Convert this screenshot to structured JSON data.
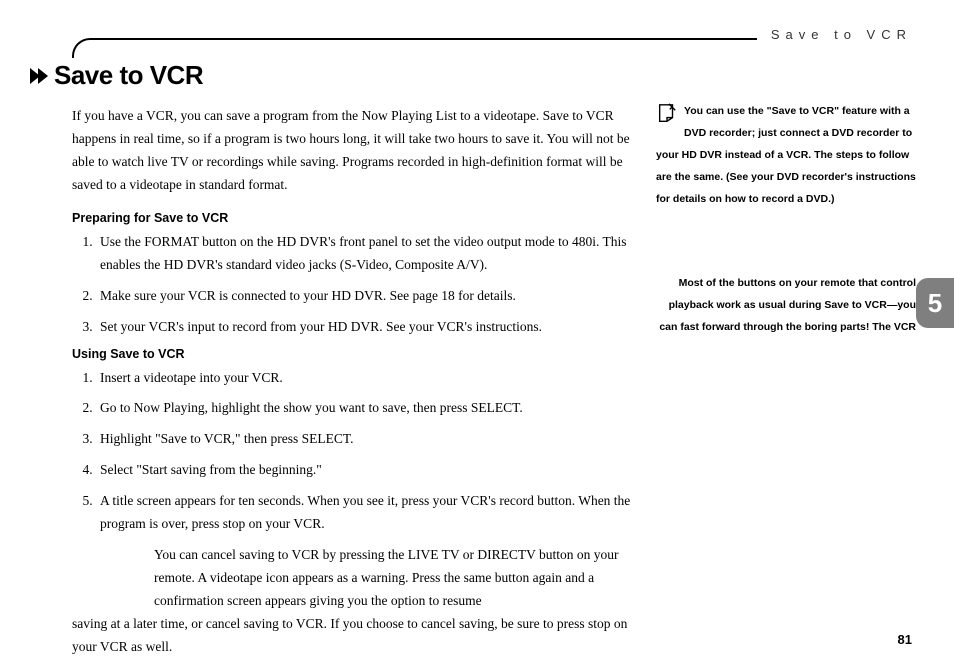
{
  "header": {
    "running_title": "Save to VCR"
  },
  "title": "Save to VCR",
  "intro": "If you have a VCR, you can save a program from the Now Playing List to a videotape. Save to VCR happens in real time, so if a program is two hours long, it will take two hours to save it. You will not be able to watch live TV or recordings while saving. Programs recorded in high-definition format will be saved to a videotape in standard format.",
  "section1": {
    "heading": "Preparing for Save to VCR",
    "steps": [
      "Use the FORMAT button on the HD DVR's front panel to set the video output mode to 480i. This enables the HD DVR's standard video jacks (S-Video, Composite A/V).",
      "Make sure your VCR is connected to your HD DVR. See page 18 for details.",
      "Set your VCR's input to record from your HD DVR. See your VCR's instructions."
    ]
  },
  "section2": {
    "heading": "Using Save to VCR",
    "steps": [
      "Insert a videotape into your VCR.",
      "Go to Now Playing, highlight the show you want to save, then press SELECT.",
      "Highlight \"Save to VCR,\" then press SELECT.",
      "Select \"Start saving from the beginning.\"",
      "A title screen appears for ten seconds. When you see it, press your VCR's record button. When the program is over, press stop on your VCR."
    ]
  },
  "cancel_note": {
    "indented": "You can cancel saving to VCR by pressing the LIVE TV or DIRECTV button on your remote. A videotape icon appears as a warning. Press the same button again and a confirmation screen appears giving you the option to resume",
    "flush": "saving at a later time, or cancel saving to VCR. If you choose to cancel saving, be sure to press stop on your VCR as well."
  },
  "sidebar": {
    "tip1": "You can use the \"Save to VCR\" feature with a DVD recorder; just connect a DVD recorder to your HD DVR instead of a VCR. The steps to follow are the same. (See your DVD recorder's instructions for details on how to record a DVD.)",
    "tip2": "Most of the buttons on your remote that control playback work as usual during Save to VCR—you can fast forward through the boring parts! The VCR"
  },
  "chapter_tab": "5",
  "page_number": "81"
}
